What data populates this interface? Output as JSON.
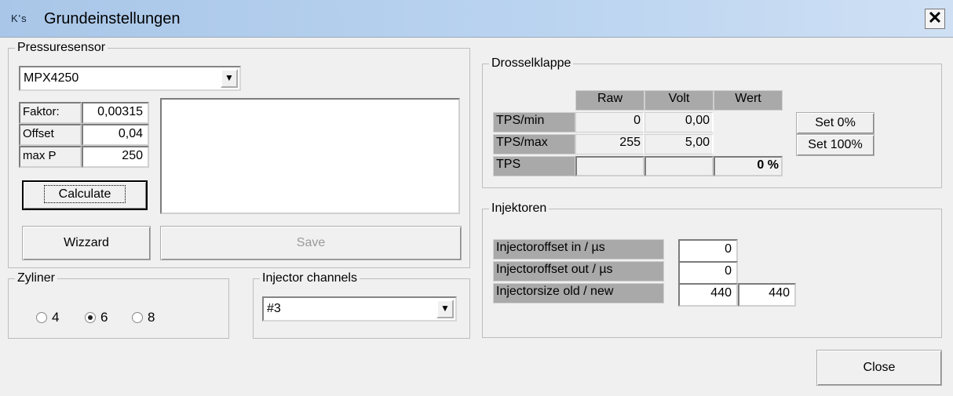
{
  "window": {
    "icon_text": "K's",
    "title": "Grundeinstellungen",
    "close_glyph": "✕"
  },
  "pressuresensor": {
    "legend": "Pressuresensor",
    "sensor_selected": "MPX4250",
    "faktor_label": "Faktor:",
    "faktor_value": "0,00315",
    "offset_label": "Offset",
    "offset_value": "0,04",
    "maxp_label": "max P",
    "maxp_value": "250",
    "calculate_label": "Calculate",
    "wizzard_label": "Wizzard",
    "save_label": "Save"
  },
  "zyliner": {
    "legend": "Zyliner",
    "options": [
      "4",
      "6",
      "8"
    ],
    "selected": "6"
  },
  "injector_channels": {
    "legend": "Injector channels",
    "selected": "#3"
  },
  "drosselklappe": {
    "legend": "Drosselklappe",
    "columns": [
      "Raw",
      "Volt",
      "Wert"
    ],
    "rows": [
      {
        "label": "TPS/min",
        "raw": "0",
        "volt": "0,00",
        "wert": ""
      },
      {
        "label": "TPS/max",
        "raw": "255",
        "volt": "5,00",
        "wert": ""
      },
      {
        "label": "TPS",
        "raw": "",
        "volt": "",
        "wert": "0 %"
      }
    ],
    "set0_label": "Set 0%",
    "set100_label": "Set 100%"
  },
  "injektoren": {
    "legend": "Injektoren",
    "offset_in_label": "Injectoroffset in / µs",
    "offset_in_value": "0",
    "offset_out_label": "Injectoroffset out / µs",
    "offset_out_value": "0",
    "size_label": "Injectorsize old / new",
    "size_old": "440",
    "size_new": "440"
  },
  "footer": {
    "close_label": "Close"
  },
  "colors": {
    "titlebar_start": "#a9c6e8",
    "grid_header": "#a9a9a9"
  }
}
